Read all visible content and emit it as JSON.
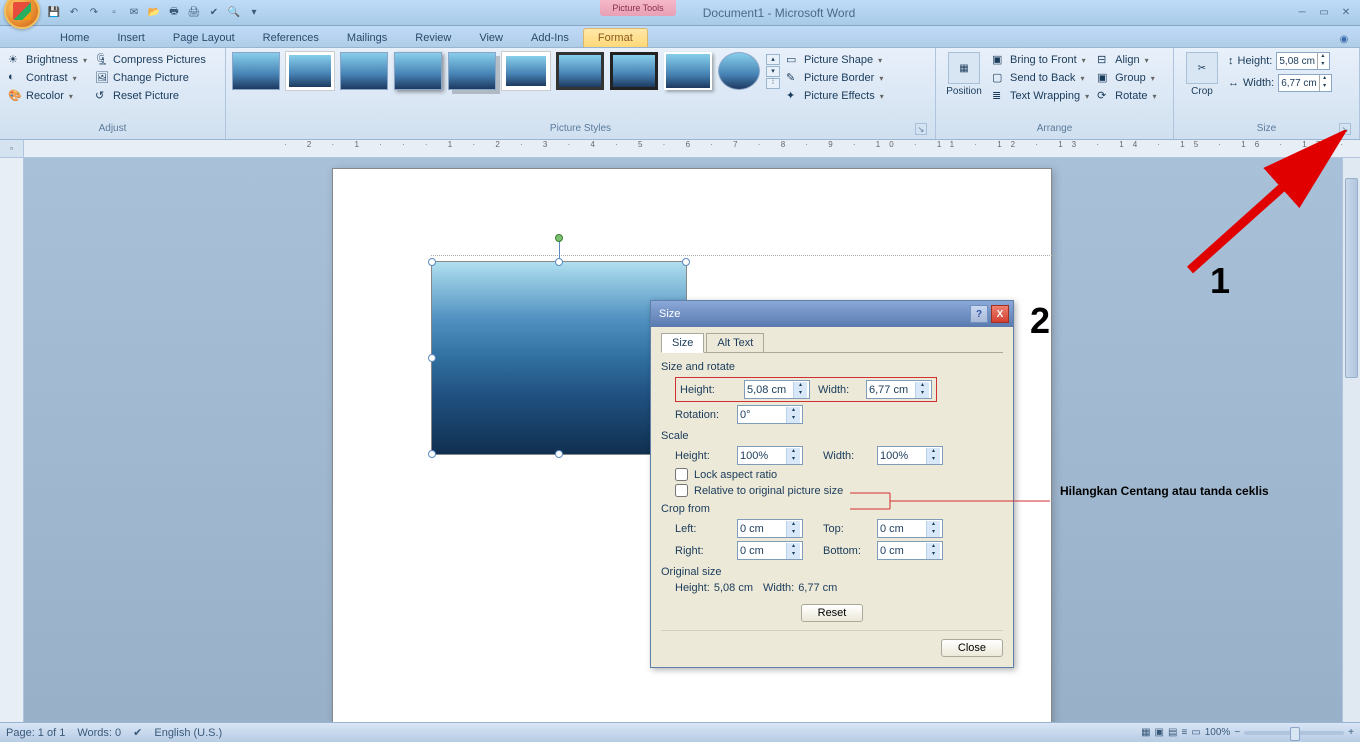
{
  "title": "Document1 - Microsoft Word",
  "context_tab": "Picture Tools",
  "tabs": [
    "Home",
    "Insert",
    "Page Layout",
    "References",
    "Mailings",
    "Review",
    "View",
    "Add-Ins"
  ],
  "active_tab": "Format",
  "ribbon": {
    "adjust": {
      "label": "Adjust",
      "items_left": [
        "Brightness",
        "Contrast",
        "Recolor"
      ],
      "items_right": [
        "Compress Pictures",
        "Change Picture",
        "Reset Picture"
      ]
    },
    "picture_styles": {
      "label": "Picture Styles",
      "shape": "Picture Shape",
      "border": "Picture Border",
      "effects": "Picture Effects"
    },
    "arrange": {
      "label": "Arrange",
      "position": "Position",
      "front": "Bring to Front",
      "back": "Send to Back",
      "wrap": "Text Wrapping",
      "align": "Align",
      "group": "Group",
      "rotate": "Rotate"
    },
    "size": {
      "label": "Size",
      "crop": "Crop",
      "height_label": "Height:",
      "width_label": "Width:",
      "height_val": "5,08 cm",
      "width_val": "6,77 cm"
    }
  },
  "dialog": {
    "title": "Size",
    "tabs": {
      "size": "Size",
      "alt": "Alt Text"
    },
    "size_rotate": "Size and rotate",
    "height_lbl": "Height:",
    "height_val": "5,08 cm",
    "width_lbl": "Width:",
    "width_val": "6,77 cm",
    "rotation_lbl": "Rotation:",
    "rotation_val": "0°",
    "scale": "Scale",
    "scale_h_lbl": "Height:",
    "scale_h_val": "100%",
    "scale_w_lbl": "Width:",
    "scale_w_val": "100%",
    "lock_aspect": "Lock aspect ratio",
    "relative_orig": "Relative to original picture size",
    "crop_from": "Crop from",
    "crop_left_lbl": "Left:",
    "crop_left_val": "0 cm",
    "crop_top_lbl": "Top:",
    "crop_top_val": "0 cm",
    "crop_right_lbl": "Right:",
    "crop_right_val": "0 cm",
    "crop_bottom_lbl": "Bottom:",
    "crop_bottom_val": "0 cm",
    "original": "Original size",
    "orig_text_h": "Height:",
    "orig_h": "5,08 cm",
    "orig_text_w": "Width:",
    "orig_w": "6,77 cm",
    "reset": "Reset",
    "close": "Close"
  },
  "annotations": {
    "one": "1",
    "two": "2",
    "text": "Hilangkan Centang atau tanda ceklis"
  },
  "statusbar": {
    "page": "Page: 1 of 1",
    "words": "Words: 0",
    "lang": "English (U.S.)",
    "zoom": "100%"
  }
}
